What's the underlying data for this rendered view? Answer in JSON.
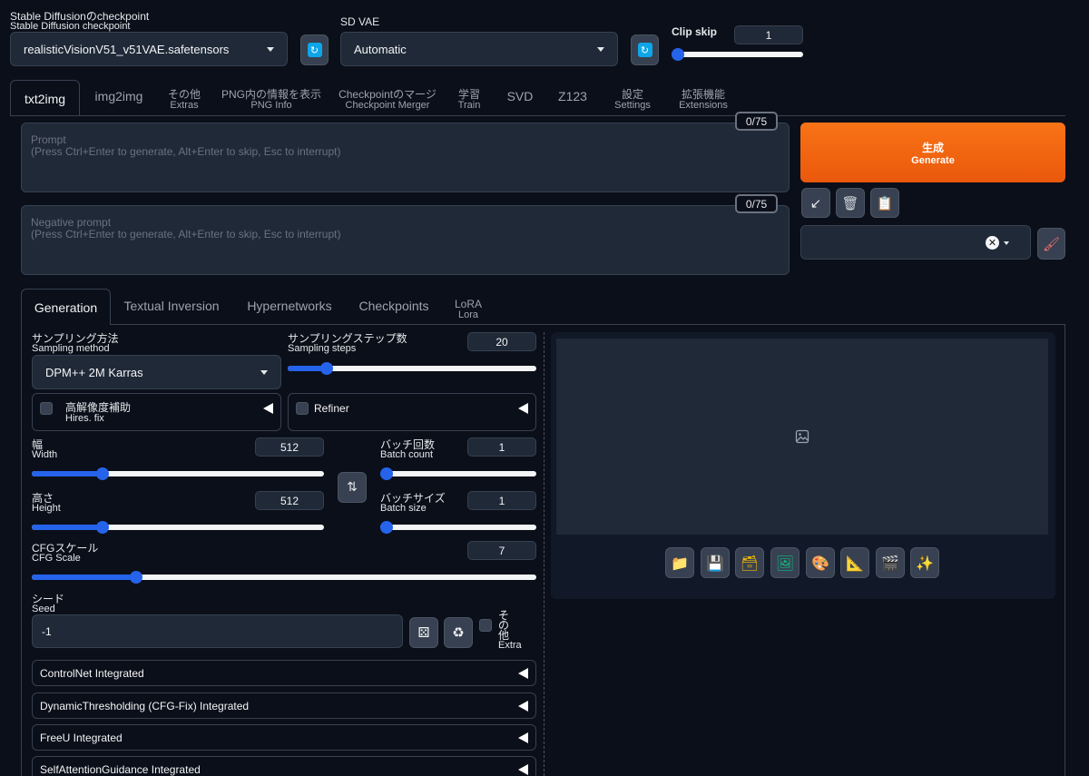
{
  "top": {
    "checkpoint": {
      "label_ja": "Stable Diffusionのcheckpoint",
      "label_en": "Stable Diffusion checkpoint",
      "value": "realisticVisionV51_v51VAE.safetensors"
    },
    "vae": {
      "label": "SD VAE",
      "value": "Automatic"
    },
    "clip_skip": {
      "label": "Clip skip",
      "value": "1",
      "level": 0.0
    }
  },
  "tabs": [
    {
      "label": "txt2img",
      "sub": ""
    },
    {
      "label": "img2img",
      "sub": ""
    },
    {
      "label": "その他",
      "sub": "Extras"
    },
    {
      "label": "PNG内の情報を表示",
      "sub": "PNG Info"
    },
    {
      "label": "Checkpointのマージ",
      "sub": "Checkpoint Merger"
    },
    {
      "label": "学習",
      "sub": "Train"
    },
    {
      "label": "SVD",
      "sub": ""
    },
    {
      "label": "Z123",
      "sub": ""
    },
    {
      "label": "設定",
      "sub": "Settings"
    },
    {
      "label": "拡張機能",
      "sub": "Extensions"
    }
  ],
  "prompt": {
    "label": "Prompt",
    "placeholder": "(Press Ctrl+Enter to generate, Alt+Enter to skip, Esc to interrupt)",
    "counter": "0/75"
  },
  "negative": {
    "label": "Negative prompt",
    "placeholder": "(Press Ctrl+Enter to generate, Alt+Enter to skip, Esc to interrupt)",
    "counter": "0/75"
  },
  "generate": {
    "label_ja": "生成",
    "label_en": "Generate"
  },
  "subtabs": [
    {
      "label": "Generation",
      "sub": ""
    },
    {
      "label": "Textual Inversion",
      "sub": ""
    },
    {
      "label": "Hypernetworks",
      "sub": ""
    },
    {
      "label": "Checkpoints",
      "sub": ""
    },
    {
      "label": "LoRA",
      "sub": "Lora"
    }
  ],
  "sampling_method": {
    "label_ja": "サンプリング方法",
    "label_en": "Sampling method",
    "value": "DPM++ 2M Karras"
  },
  "sampling_steps": {
    "label_ja": "サンプリングステップ数",
    "label_en": "Sampling steps",
    "value": "20",
    "level": 0.14
  },
  "hires": {
    "label_ja": "高解像度補助",
    "label_en": "Hires. fix"
  },
  "refiner": {
    "label": "Refiner"
  },
  "width": {
    "label_ja": "幅",
    "label_en": "Width",
    "value": "512",
    "level": 0.23
  },
  "height": {
    "label_ja": "高さ",
    "label_en": "Height",
    "value": "512",
    "level": 0.23
  },
  "batch_count": {
    "label_ja": "バッチ回数",
    "label_en": "Batch count",
    "value": "1",
    "level": 0.0
  },
  "batch_size": {
    "label_ja": "バッチサイズ",
    "label_en": "Batch size",
    "value": "1",
    "level": 0.0
  },
  "cfg": {
    "label_ja": "CFGスケール",
    "label_en": "CFG Scale",
    "value": "7",
    "level": 0.2
  },
  "seed": {
    "label_ja": "シード",
    "label_en": "Seed",
    "value": "-1",
    "extra_ja": "その他",
    "extra_en": "Extra"
  },
  "accordions": [
    "ControlNet Integrated",
    "DynamicThresholding (CFG-Fix) Integrated",
    "FreeU Integrated",
    "SelfAttentionGuidance Integrated"
  ],
  "swap_icon": "swap-arrows-icon",
  "image_actions": [
    "folder-icon",
    "save-icon",
    "zip-icon",
    "image-icon",
    "palette-icon",
    "ruler-icon",
    "video-icon",
    "sparkles-icon"
  ]
}
